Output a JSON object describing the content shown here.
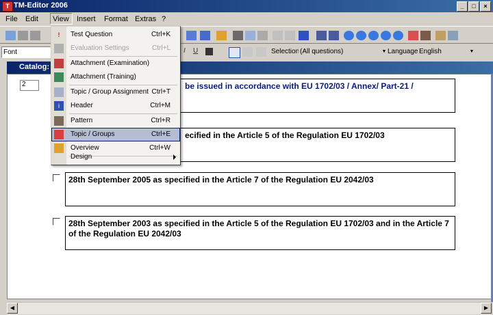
{
  "title": "TM-Editor 2006",
  "window_buttons": [
    "_",
    "□",
    "×"
  ],
  "menubar": [
    "File",
    "Edit",
    "View",
    "Insert",
    "Format",
    "Extras",
    "?"
  ],
  "format_bar": {
    "font_label": "Font",
    "selection_label": "Selection",
    "selection_value": "(All questions)",
    "language_label": "Language",
    "language_value": "English"
  },
  "catalog_title": "Catalog:",
  "question_number": "2",
  "view_menu": {
    "items": [
      {
        "label": "Test Question",
        "shortcut": "Ctrl+K",
        "icon": "question-icon",
        "disabled": false
      },
      {
        "label": "Evaluation Settings",
        "shortcut": "Ctrl+L",
        "icon": "settings-icon",
        "disabled": true
      },
      {
        "label": "Attachment (Examination)",
        "shortcut": "",
        "icon": "book-icon",
        "disabled": false
      },
      {
        "label": "Attachment (Training)",
        "shortcut": "",
        "icon": "book-green-icon",
        "disabled": false
      },
      {
        "label": "Topic / Group Assignment",
        "shortcut": "Ctrl+T",
        "icon": "assignment-icon",
        "disabled": false
      },
      {
        "label": "Header",
        "shortcut": "Ctrl+M",
        "icon": "header-icon",
        "disabled": false
      },
      {
        "label": "Pattern",
        "shortcut": "Ctrl+R",
        "icon": "pattern-icon",
        "disabled": false
      },
      {
        "label": "Topic / Groups",
        "shortcut": "Ctrl+E",
        "icon": "groups-icon",
        "disabled": false,
        "highlighted": true
      },
      {
        "label": "Overview",
        "shortcut": "Ctrl+W",
        "icon": "overview-icon",
        "disabled": false
      },
      {
        "label": "Design",
        "shortcut": "",
        "icon": "",
        "disabled": false,
        "submenu": true
      }
    ]
  },
  "answers": [
    {
      "text": "be issued in accordance with EU 1702/03 / Annex/ Part-21 /",
      "checkbox": false
    },
    {
      "text": "ecified in the Article 5 of the Regulation EU 1702/03",
      "checkbox": false
    },
    {
      "text": "28th September 2005 as specified in the Article 7 of the Regulation EU 2042/03",
      "checkbox": true
    },
    {
      "text": "28th September 2003 as specified in the Article 5 of the Regulation EU 1702/03 and in the Article 7 of the Regulation EU 2042/03",
      "checkbox": true
    }
  ],
  "colors": {
    "title_bar": "#0a246a",
    "menu_highlight": "#b6bdd2",
    "first_answer_text": "#0a1a7a"
  }
}
